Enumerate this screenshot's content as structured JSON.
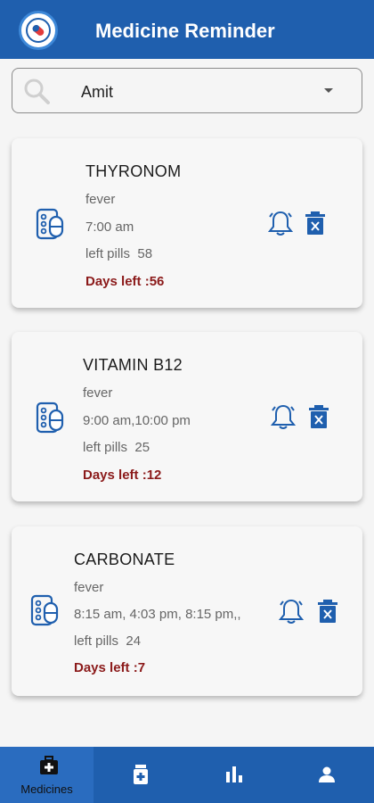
{
  "app": {
    "title": "Medicine Reminder"
  },
  "search": {
    "value": "Amit"
  },
  "medicines": [
    {
      "name": "THYRONOM",
      "reason": "fever",
      "times": "7:00 am",
      "left_pills_label": "left pills",
      "left_pills": "58",
      "days_left": "Days left :56"
    },
    {
      "name": "VITAMIN B12",
      "reason": "fever",
      "times": "9:00 am,10:00 pm",
      "left_pills_label": "left pills",
      "left_pills": "25",
      "days_left": "Days left :12"
    },
    {
      "name": "CARBONATE",
      "reason": "fever",
      "times": "8:15 am, 4:03 pm, 8:15 pm,,",
      "left_pills_label": "left pills",
      "left_pills": "24",
      "days_left": "Days left :7"
    }
  ],
  "bottom_nav": {
    "items": [
      {
        "label": "Medicines",
        "icon": "medical-bag-icon",
        "active": true
      },
      {
        "label": "",
        "icon": "medicine-bottle-icon",
        "active": false
      },
      {
        "label": "",
        "icon": "bar-chart-icon",
        "active": false
      },
      {
        "label": "",
        "icon": "person-icon",
        "active": false
      }
    ]
  },
  "colors": {
    "primary": "#1f5fae",
    "days_left": "#8b1a1a",
    "icon": "#1f5fae"
  }
}
